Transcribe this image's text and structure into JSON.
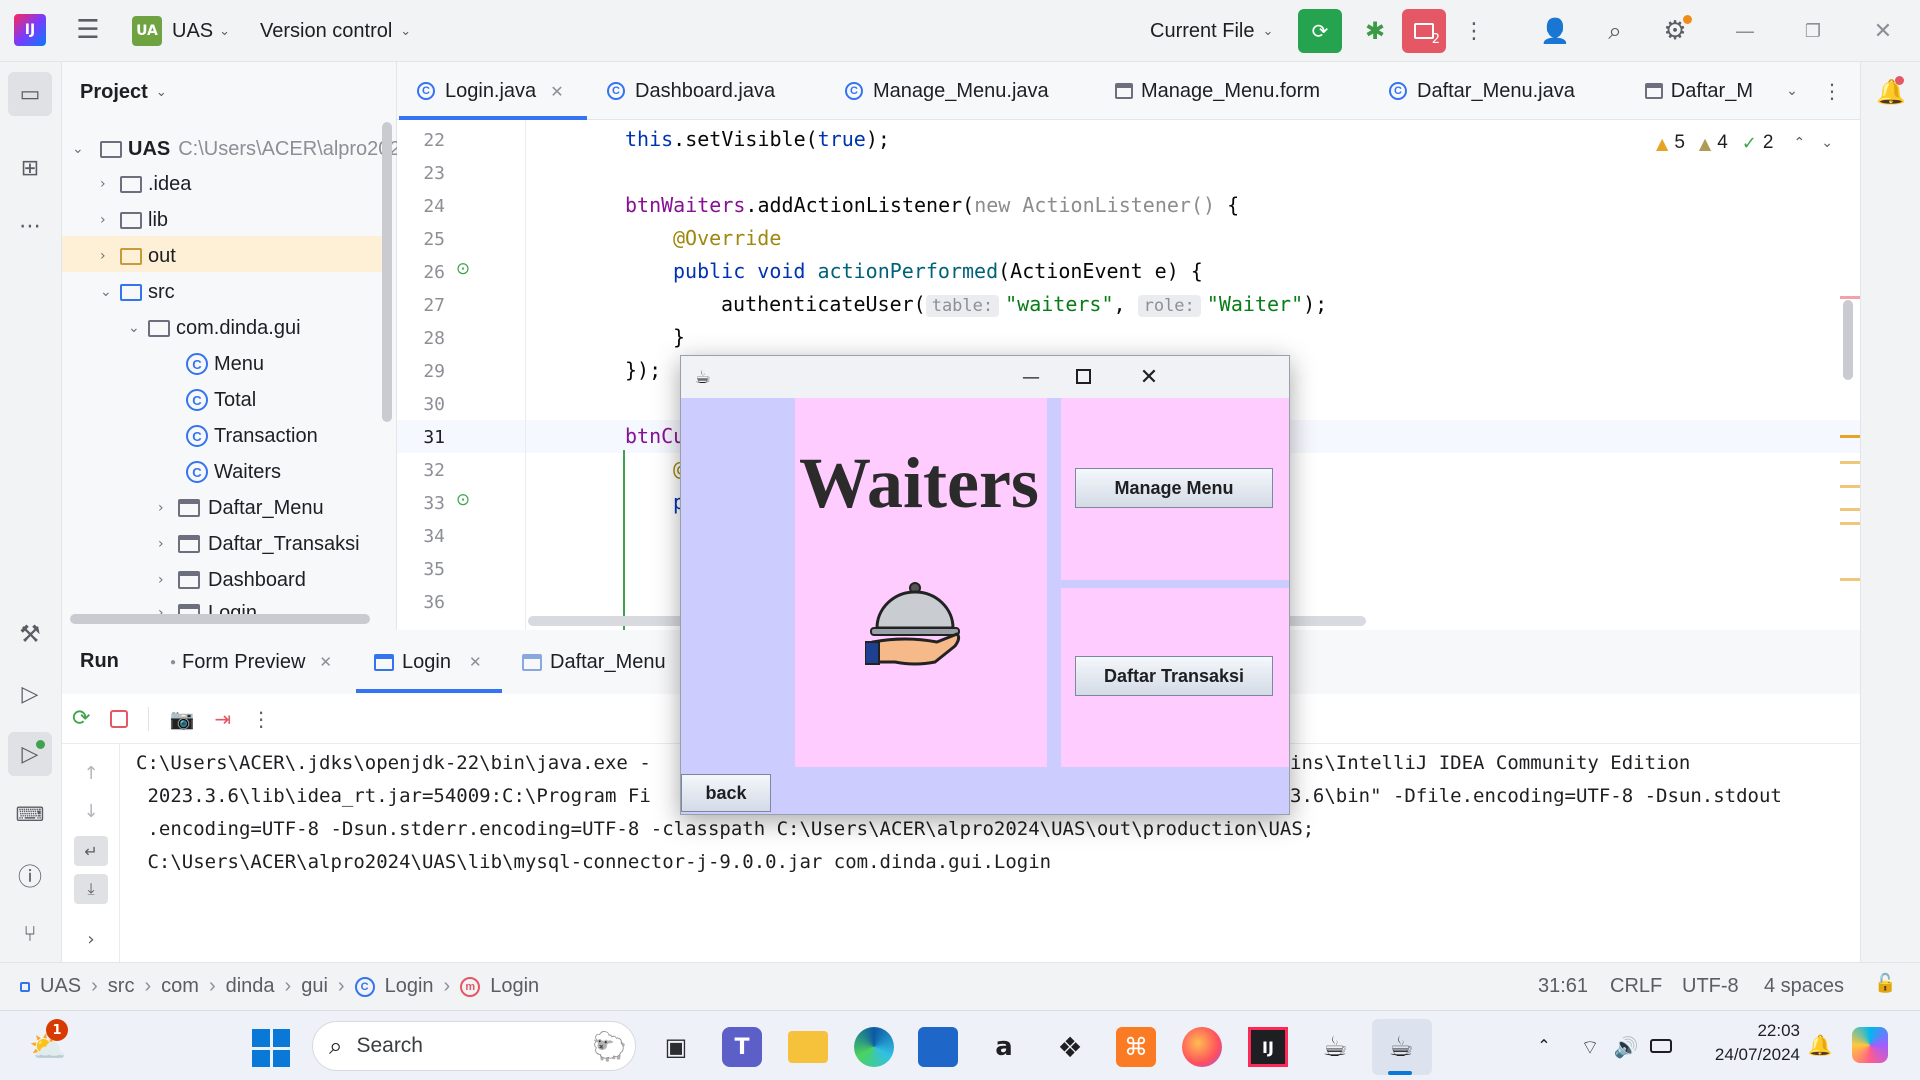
{
  "topbar": {
    "project_badge": "UA",
    "project_name": "UAS",
    "vcs_label": "Version control",
    "run_config": "Current File",
    "notif_count": "2"
  },
  "project_panel": {
    "title": "Project",
    "root_name": "UAS",
    "root_path": "C:\\Users\\ACER\\alpro202",
    "items": [
      {
        "label": ".idea"
      },
      {
        "label": "lib"
      },
      {
        "label": "out"
      },
      {
        "label": "src"
      },
      {
        "label": "com.dinda.gui"
      },
      {
        "label": "Menu"
      },
      {
        "label": "Total"
      },
      {
        "label": "Transaction"
      },
      {
        "label": "Waiters"
      },
      {
        "label": "Daftar_Menu"
      },
      {
        "label": "Daftar_Transaksi"
      },
      {
        "label": "Dashboard"
      },
      {
        "label": "Login"
      }
    ]
  },
  "editor_tabs": [
    {
      "label": "Login.java"
    },
    {
      "label": "Dashboard.java"
    },
    {
      "label": "Manage_Menu.java"
    },
    {
      "label": "Manage_Menu.form"
    },
    {
      "label": "Daftar_Menu.java"
    },
    {
      "label": "Daftar_M"
    }
  ],
  "inspections": {
    "warnings": "5",
    "weak": "4",
    "ok": "2"
  },
  "line_numbers": [
    "22",
    "23",
    "24",
    "25",
    "26",
    "27",
    "28",
    "29",
    "30",
    "31",
    "32",
    "33",
    "34",
    "35",
    "36"
  ],
  "code": {
    "l22_a": "this",
    "l22_b": ".setVisible(",
    "l22_c": "true",
    "l22_d": ");",
    "l24_a": "btnWaiters",
    "l24_b": ".addActionListener(",
    "l24_c": "new ActionListener()",
    "l24_d": " {",
    "l25": "@Override",
    "l26_a": "public void ",
    "l26_b": "actionPerformed",
    "l26_c": "(ActionEvent e) {",
    "l27_a": "authenticateUser(",
    "l27_h1": "table:",
    "l27_s1": "\"waiters\"",
    "l27_m": ", ",
    "l27_h2": "role:",
    "l27_s2": "\"Waiter\"",
    "l27_e": ");",
    "l28": "}",
    "l29": "});",
    "l31": "btnCu",
    "l32": "@",
    "l33": "p"
  },
  "run_panel": {
    "title": "Run",
    "tabs": [
      {
        "label": "Form Preview"
      },
      {
        "label": "Login"
      },
      {
        "label": "Daftar_Menu"
      }
    ],
    "console": [
      "C:\\Users\\ACER\\.jdks\\openjdk-22\\bin\\java.exe -",
      " 2023.3.6\\lib\\idea_rt.jar=54009:C:\\Program Fi",
      " .encoding=UTF-8 -Dsun.stderr.encoding=UTF-8 -classpath C:\\Users\\ACER\\alpro2024\\UAS\\out\\production\\UAS;",
      " C:\\Users\\ACER\\alpro2024\\UAS\\lib\\mysql-connector-j-9.0.0.jar com.dinda.gui.Login"
    ],
    "console_right": [
      "ins\\IntelliJ IDEA Community Edition",
      "3.6\\bin\" -Dfile.encoding=UTF-8 -Dsun.stdout"
    ]
  },
  "statusbar": {
    "crumbs": [
      "UAS",
      "src",
      "com",
      "dinda",
      "gui",
      "Login",
      "Login"
    ],
    "position": "31:61",
    "line_sep": "CRLF",
    "encoding": "UTF-8",
    "indent": "4 spaces"
  },
  "swing_window": {
    "heading": "Waiters",
    "btn_manage": "Manage Menu",
    "btn_transaksi": "Daftar Transaksi",
    "btn_back": "back",
    "colors": {
      "lavender": "#ccccff",
      "pink": "#ffccff"
    }
  },
  "taskbar": {
    "search_placeholder": "Search",
    "weather_badge": "1",
    "time": "22:03",
    "date": "24/07/2024"
  }
}
